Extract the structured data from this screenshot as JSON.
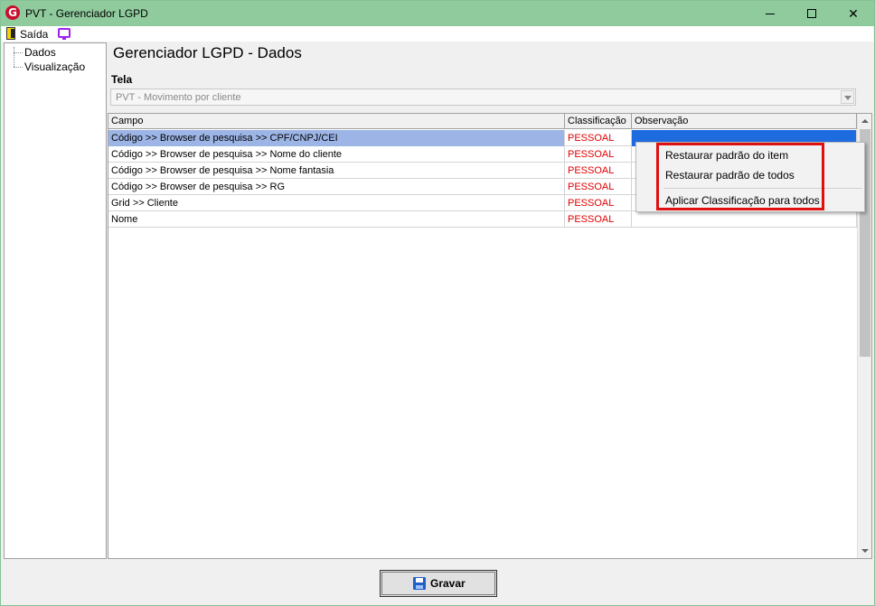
{
  "window": {
    "title": "PVT - Gerenciador LGPD"
  },
  "menu": {
    "saida_label": "Saída"
  },
  "tree": {
    "items": [
      "Dados",
      "Visualização"
    ]
  },
  "page": {
    "title": "Gerenciador LGPD - Dados",
    "tela_label": "Tela",
    "tela_value": "PVT - Movimento por cliente"
  },
  "grid": {
    "columns": [
      "Campo",
      "Classificação",
      "Observação"
    ],
    "rows": [
      {
        "campo": "Código >> Browser de pesquisa >> CPF/CNPJ/CEI",
        "classificacao": "PESSOAL",
        "observacao": ""
      },
      {
        "campo": "Código >> Browser de pesquisa >> Nome do cliente",
        "classificacao": "PESSOAL",
        "observacao": ""
      },
      {
        "campo": "Código >> Browser de pesquisa >> Nome fantasia",
        "classificacao": "PESSOAL",
        "observacao": ""
      },
      {
        "campo": "Código >> Browser de pesquisa >> RG",
        "classificacao": "PESSOAL",
        "observacao": ""
      },
      {
        "campo": "Grid >> Cliente",
        "classificacao": "PESSOAL",
        "observacao": ""
      },
      {
        "campo": "Nome",
        "classificacao": "PESSOAL",
        "observacao": ""
      }
    ],
    "selected_row": 0
  },
  "context_menu": {
    "items": [
      "Restaurar padrão do item",
      "Restaurar padrão de todos",
      "Aplicar Classificação para todos"
    ]
  },
  "footer": {
    "gravar_label": "Gravar"
  },
  "colors": {
    "titlebar": "#8fcb9d",
    "classification_text": "#e00000",
    "selection": "#9db5e6",
    "highlight_border": "#e01010"
  },
  "icons": [
    "app-logo-icon",
    "exit-door-icon",
    "monitor-icon",
    "save-disk-icon"
  ]
}
